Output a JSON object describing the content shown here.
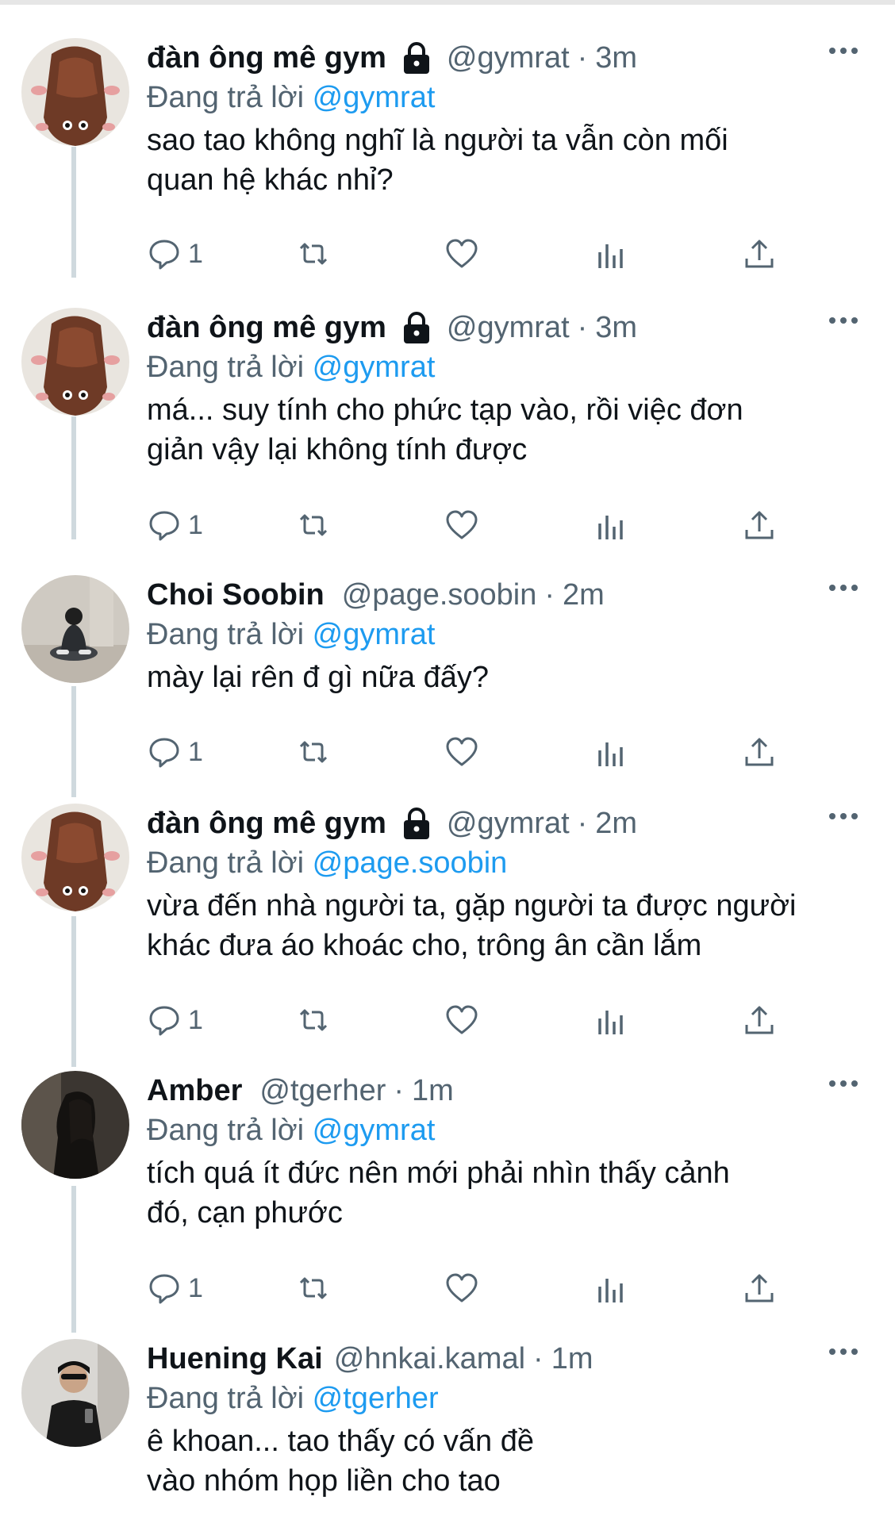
{
  "colors": {
    "text": "#0f1419",
    "muted": "#536471",
    "mention": "#1d9bf0",
    "thread_line": "#cfd9de"
  },
  "reply_prefix": "Đang trả lời",
  "tweets": [
    {
      "avatar": "rat-costume-avatar",
      "display_name": "đàn ông mê gym",
      "protected": true,
      "handle": "@gymrat",
      "time": "3m",
      "reply_to": "@gymrat",
      "text": "sao tao không nghĩ là người ta vẫn còn mối\nquan hệ khác nhỉ?",
      "reply_count": "1"
    },
    {
      "avatar": "rat-costume-avatar",
      "display_name": "đàn ông mê gym",
      "protected": true,
      "handle": "@gymrat",
      "time": "3m",
      "reply_to": "@gymrat",
      "text": "má... suy tính cho phức tạp vào, rồi việc đơn\ngiản vậy lại không tính được",
      "reply_count": "1"
    },
    {
      "avatar": "seated-person-avatar",
      "display_name": "Choi Soobin",
      "protected": false,
      "handle": "@page.soobin",
      "time": "2m",
      "reply_to": "@gymrat",
      "text": "mày lại rên đ gì nữa đấy?",
      "reply_count": "1"
    },
    {
      "avatar": "rat-costume-avatar",
      "display_name": "đàn ông mê gym",
      "protected": true,
      "handle": "@gymrat",
      "time": "2m",
      "reply_to": "@page.soobin",
      "text": "vừa đến nhà người ta, gặp người ta được người\nkhác đưa áo khoác cho, trông ân cần lắm",
      "reply_count": "1"
    },
    {
      "avatar": "dark-portrait-avatar",
      "display_name": "Amber",
      "protected": false,
      "handle": "@tgerher",
      "time": "1m",
      "reply_to": "@gymrat",
      "text": "tích quá ít đức nên mới phải nhìn thấy cảnh\nđó, cạn phước",
      "reply_count": "1"
    },
    {
      "avatar": "mirror-selfie-avatar",
      "display_name": "Huening Kai",
      "protected": false,
      "handle": "@hnkai.kamal",
      "time": "1m",
      "reply_to": "@tgerher",
      "text": "ê khoan... tao thấy có vấn đề\nvào nhóm họp liền cho tao",
      "reply_count": ""
    }
  ]
}
